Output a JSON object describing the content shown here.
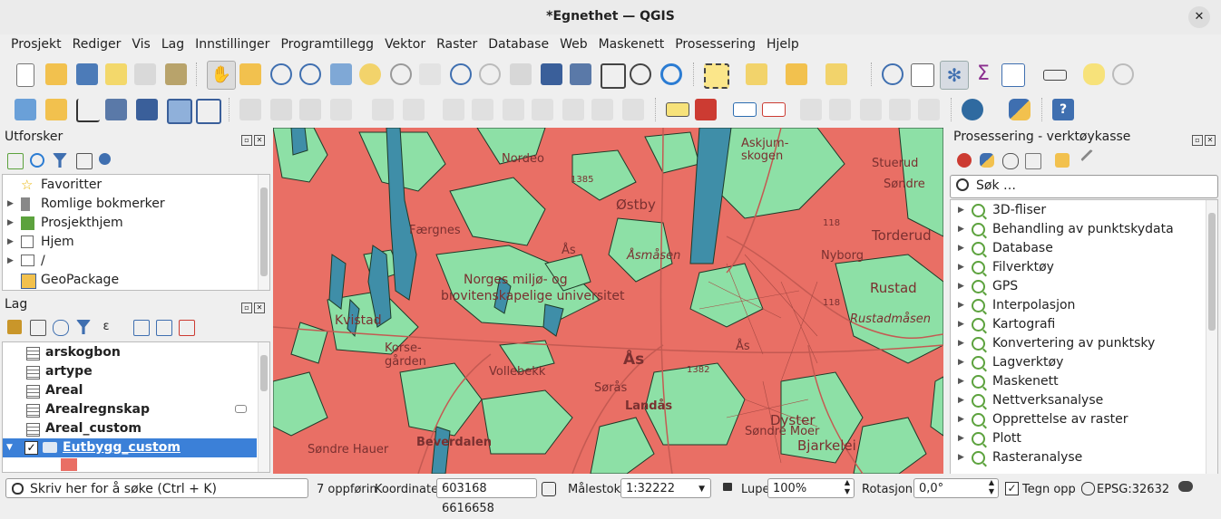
{
  "window": {
    "title": "*Egnethet — QGIS",
    "close_glyph": "✕"
  },
  "menu": [
    "Prosjekt",
    "Rediger",
    "Vis",
    "Lag",
    "Innstillinger",
    "Programtillegg",
    "Vektor",
    "Raster",
    "Database",
    "Web",
    "Maskenett",
    "Prosessering",
    "Hjelp"
  ],
  "browser": {
    "title": "Utforsker",
    "items": [
      {
        "label": "Favoritter",
        "icon": "star-icon",
        "expandable": false
      },
      {
        "label": "Romlige bokmerker",
        "icon": "bookmark-icon",
        "expandable": true
      },
      {
        "label": "Prosjekthjem",
        "icon": "project-home-icon",
        "expandable": true
      },
      {
        "label": "Hjem",
        "icon": "home-folder-icon",
        "expandable": true
      },
      {
        "label": "/",
        "icon": "folder-icon",
        "expandable": true
      },
      {
        "label": "GeoPackage",
        "icon": "geopackage-icon",
        "expandable": false
      }
    ]
  },
  "layers": {
    "title": "Lag",
    "items": [
      {
        "label": "arskogbon",
        "selected": false,
        "checked": false
      },
      {
        "label": "artype",
        "selected": false,
        "checked": false
      },
      {
        "label": "Areal",
        "selected": false,
        "checked": false
      },
      {
        "label": "Arealregnskap",
        "selected": false,
        "checked": false
      },
      {
        "label": "Areal_custom",
        "selected": false,
        "checked": false
      },
      {
        "label": "Eutbygg_custom",
        "selected": true,
        "checked": true
      }
    ]
  },
  "map": {
    "colors": {
      "unsuitable": "#e96f65",
      "suitable": "#8de0a6",
      "water": "#3f8ea8",
      "roads": "#c45a52"
    },
    "labels": [
      "Nordeo",
      "Askjum-",
      "skogen",
      "Østby",
      "Stuerud",
      "Søndre",
      "Torderud",
      "Færgnes",
      "Ås",
      "Åsmåsen",
      "Norges miljø- og",
      "biovitenskapelige universitet",
      "Kvistad",
      "Rustad",
      "Rustadmåsen",
      "Nyborg",
      "Korse-",
      "gården",
      "Ås",
      "Ås",
      "Vollebekk",
      "Sørås",
      "Landås",
      "Dyster",
      "Søndre Hauer",
      "Beverdalen",
      "Søndre Moer",
      "Bjarkelei",
      "1385",
      "118",
      "1382",
      "118"
    ]
  },
  "processing": {
    "title": "Prosessering - verktøykasse",
    "search_placeholder": "Søk …",
    "items": [
      "3D-fliser",
      "Behandling av punktskydata",
      "Database",
      "Filverktøy",
      "GPS",
      "Interpolasjon",
      "Kartografi",
      "Konvertering av punktsky",
      "Lagverktøy",
      "Maskenett",
      "Nettverksanalyse",
      "Opprettelse av raster",
      "Plott",
      "Rasteranalyse"
    ]
  },
  "status": {
    "search_placeholder": "Skriv her for å søke (Ctrl + K)",
    "feature_count": "7 oppførin",
    "coord_label": "Koordinater",
    "coord_value": "603168  6616658",
    "scale_label": "Målestokk",
    "scale_value": "1:32222",
    "magnifier_label": "Lupe",
    "magnifier_value": "100%",
    "rotation_label": "Rotasjon",
    "rotation_value": "0,0°",
    "render_label": "Tegn opp",
    "crs": "EPSG:32632"
  }
}
